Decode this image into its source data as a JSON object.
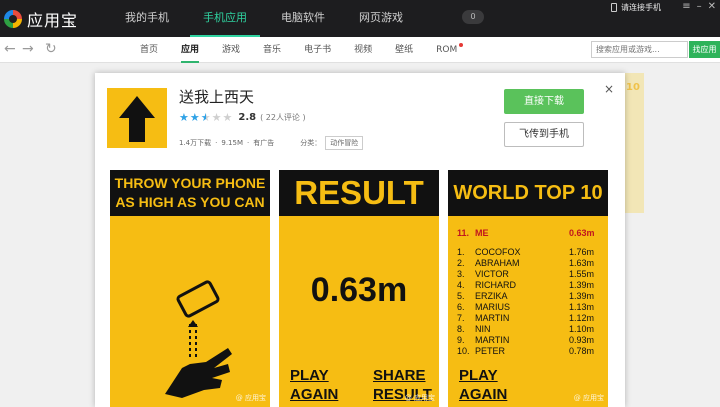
{
  "app_brand": "应用宝",
  "main_nav": [
    "我的手机",
    "手机应用",
    "电脑软件",
    "网页游戏"
  ],
  "main_nav_active": 1,
  "download_count_badge": "0",
  "connect_phone": "请连接手机",
  "sub_nav": [
    "首页",
    "应用",
    "游戏",
    "音乐",
    "电子书",
    "视频",
    "壁纸",
    "ROM"
  ],
  "sub_nav_active": 1,
  "search": {
    "placeholder": "搜索应用或游戏...",
    "button": "找应用"
  },
  "bg_hint": "10",
  "dialog": {
    "title": "送我上西天",
    "rating": "2.8",
    "rating_value": 2.5,
    "rating_max": 5,
    "reviews": "( 22人评论 )",
    "downloads": "1.4万下载",
    "size": "9.15M",
    "ads": "有广告",
    "category_label": "分类：",
    "category": "动作冒险",
    "download_button": "直接下载",
    "send_button": "飞传到手机",
    "close": "×"
  },
  "screenshots": {
    "shot1": {
      "header": "THROW YOUR PHONE AS HIGH AS YOU CAN",
      "watermark": "@ 应用宝"
    },
    "shot2": {
      "header": "RESULT",
      "distance": "0.63m",
      "play_again": "PLAY AGAIN",
      "share_result": "SHARE RESULT",
      "watermark": "@ 应用宝"
    },
    "shot3": {
      "header": "WORLD TOP 10",
      "me": {
        "rank": "11.",
        "name": "ME",
        "dist": "0.63m"
      },
      "leaders": [
        {
          "rank": "1.",
          "name": "COCOFOX",
          "dist": "1.76m"
        },
        {
          "rank": "2.",
          "name": "ABRAHAM",
          "dist": "1.63m"
        },
        {
          "rank": "3.",
          "name": "VICTOR",
          "dist": "1.55m"
        },
        {
          "rank": "4.",
          "name": "RICHARD",
          "dist": "1.39m"
        },
        {
          "rank": "5.",
          "name": "ERZIKA",
          "dist": "1.39m"
        },
        {
          "rank": "6.",
          "name": "MARIUS",
          "dist": "1.13m"
        },
        {
          "rank": "7.",
          "name": "MARTIN",
          "dist": "1.12m"
        },
        {
          "rank": "8.",
          "name": "NIN",
          "dist": "1.10m"
        },
        {
          "rank": "9.",
          "name": "MARTIN",
          "dist": "0.93m"
        },
        {
          "rank": "10.",
          "name": "PETER",
          "dist": "0.78m"
        }
      ],
      "play_again": "PLAY AGAIN",
      "watermark": "@ 应用宝"
    }
  },
  "colors": {
    "accent_green": "#2fb46e",
    "game_yellow": "#f6bd13",
    "topbar": "#1d1d1f"
  }
}
